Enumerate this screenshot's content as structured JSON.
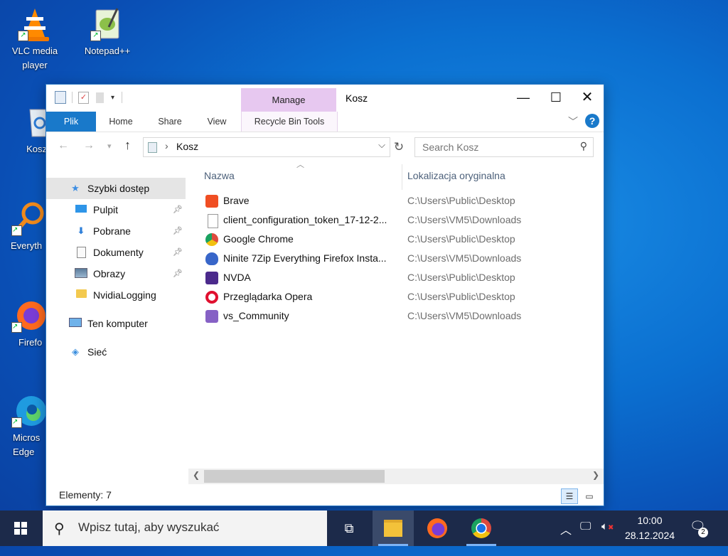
{
  "desktop": {
    "icons": [
      {
        "label": "VLC media player",
        "icon": "vlc-icon"
      },
      {
        "label": "Notepad++",
        "icon": "notepadpp-icon"
      },
      {
        "label": "Kosz",
        "icon": "recycle-bin-icon"
      },
      {
        "label": "Everyth",
        "icon": "everything-icon"
      },
      {
        "label": "Firefo",
        "icon": "firefox-icon"
      },
      {
        "label": "Micros Edge",
        "icon": "edge-icon"
      }
    ]
  },
  "window": {
    "title": "Kosz",
    "manage_tab": "Manage",
    "ribbon_tabs": [
      "Plik",
      "Home",
      "Share",
      "View",
      "Recycle Bin Tools"
    ],
    "address": {
      "crumb": "Kosz"
    },
    "search_placeholder": "Search Kosz",
    "nav": [
      {
        "label": "Szybki dostęp",
        "icon": "star-icon",
        "pinned": false
      },
      {
        "label": "Pulpit",
        "icon": "desktop-folder-icon",
        "pinned": true
      },
      {
        "label": "Pobrane",
        "icon": "downloads-icon",
        "pinned": true
      },
      {
        "label": "Dokumenty",
        "icon": "documents-icon",
        "pinned": true
      },
      {
        "label": "Obrazy",
        "icon": "pictures-icon",
        "pinned": true
      },
      {
        "label": "NvidiaLogging",
        "icon": "folder-icon",
        "pinned": false
      },
      {
        "label": "Ten komputer",
        "icon": "computer-icon",
        "pinned": false
      },
      {
        "label": "Sieć",
        "icon": "network-icon",
        "pinned": false
      }
    ],
    "columns": {
      "name": "Nazwa",
      "location": "Lokalizacja oryginalna"
    },
    "files": [
      {
        "name": "Brave",
        "location": "C:\\Users\\Public\\Desktop",
        "icon": "brave-icon",
        "color": "#f04e23"
      },
      {
        "name": "client_configuration_token_17-12-2...",
        "location": "C:\\Users\\VM5\\Downloads",
        "icon": "file-icon",
        "color": "#ffffff"
      },
      {
        "name": "Google Chrome",
        "location": "C:\\Users\\Public\\Desktop",
        "icon": "chrome-icon",
        "color": "#dd4b3e"
      },
      {
        "name": "Ninite 7Zip Everything Firefox Insta...",
        "location": "C:\\Users\\VM5\\Downloads",
        "icon": "ninite-icon",
        "color": "#3866c9"
      },
      {
        "name": "NVDA",
        "location": "C:\\Users\\Public\\Desktop",
        "icon": "nvda-icon",
        "color": "#4b2a8c"
      },
      {
        "name": "Przeglądarka Opera",
        "location": "C:\\Users\\Public\\Desktop",
        "icon": "opera-icon",
        "color": "#e0102f"
      },
      {
        "name": "vs_Community",
        "location": "C:\\Users\\VM5\\Downloads",
        "icon": "visual-studio-icon",
        "color": "#8661c5"
      }
    ],
    "status": "Elementy: 7"
  },
  "taskbar": {
    "search_placeholder": "Wpisz tutaj, aby wyszukać",
    "time": "10:00",
    "date": "28.12.2024",
    "notification_count": "2"
  }
}
